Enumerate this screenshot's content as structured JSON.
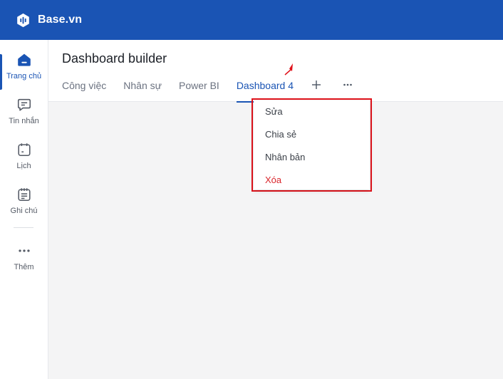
{
  "brand": {
    "name": "Base.vn",
    "logo_icon": "base-logo-icon",
    "color": "#1a54b4"
  },
  "sidebar": {
    "items": [
      {
        "label": "Trang chủ",
        "icon": "home-icon",
        "active": true
      },
      {
        "label": "Tin nhắn",
        "icon": "message-icon",
        "active": false
      },
      {
        "label": "Lịch",
        "icon": "calendar-icon",
        "active": false
      },
      {
        "label": "Ghi chú",
        "icon": "notes-icon",
        "active": false
      },
      {
        "label": "Thêm",
        "icon": "more-horizontal-icon",
        "active": false
      }
    ]
  },
  "page": {
    "title": "Dashboard builder",
    "tabs": [
      {
        "label": "Công việc",
        "active": false
      },
      {
        "label": "Nhân sự",
        "active": false
      },
      {
        "label": "Power BI",
        "active": false
      },
      {
        "label": "Dashboard 4",
        "active": true
      }
    ],
    "add_tab_icon": "plus-icon",
    "more_icon": "ellipsis-icon"
  },
  "context_menu": {
    "items": [
      {
        "label": "Sửa",
        "danger": false
      },
      {
        "label": "Chia sẻ",
        "danger": false
      },
      {
        "label": "Nhân bản",
        "danger": false
      },
      {
        "label": "Xóa",
        "danger": true
      }
    ],
    "highlight_color": "#e0131b",
    "danger_color": "#d9262c"
  }
}
